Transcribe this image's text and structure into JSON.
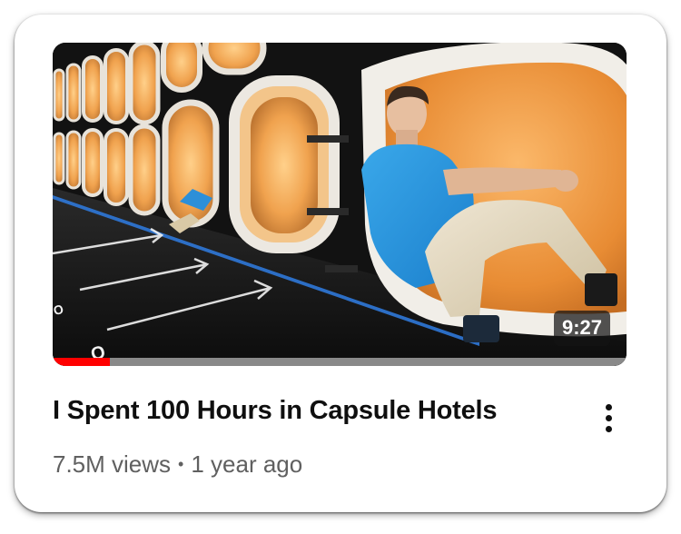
{
  "video": {
    "title": "I Spent 100 Hours in Capsule Hotels",
    "duration": "9:27",
    "views": "7.5M views",
    "separator": "•",
    "age": "1 year ago",
    "watch_progress": 0.1,
    "thumbnail_icon": "capsule-hotel-thumbnail"
  },
  "menu": {
    "icon": "more-vertical-icon"
  },
  "colors": {
    "progress": "#ff0000",
    "title": "#0f0f0f",
    "meta": "#606060"
  }
}
